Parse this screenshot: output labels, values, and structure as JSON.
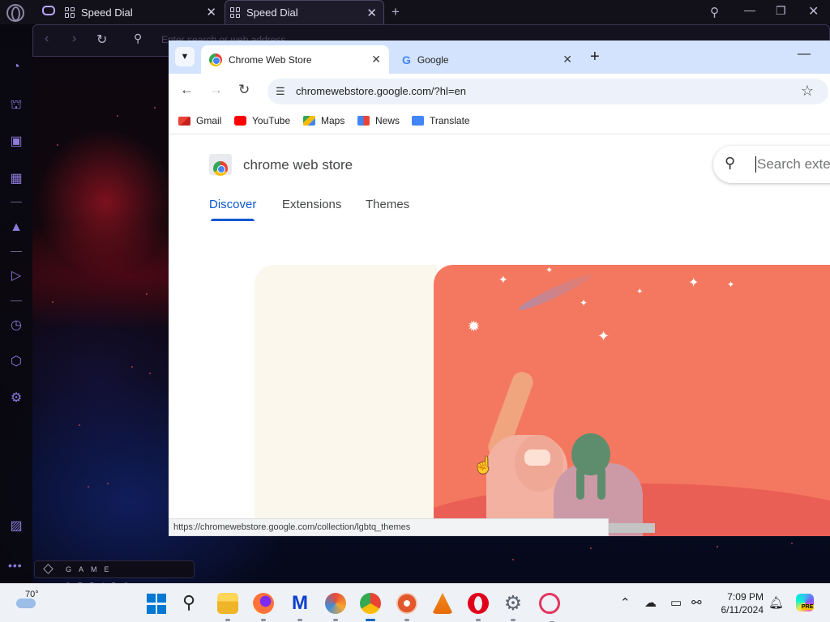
{
  "opera": {
    "tabs": [
      {
        "label": "Speed Dial",
        "icon": "speed-dial-icon"
      },
      {
        "label": "Speed Dial",
        "icon": "speed-dial-icon",
        "active": true
      }
    ],
    "address_placeholder": "Enter search or web address",
    "game_strips_label": "GAME STRIPS",
    "sidebar_icons": [
      "speedometer-icon",
      "game-controller-icon",
      "twitch-icon",
      "cpu-icon",
      "arc-icon",
      "player-icon",
      "history-icon",
      "cube-icon",
      "settings-gear-icon",
      "gallery-icon",
      "more-dots-icon"
    ],
    "accent_color": "#8d7bdc"
  },
  "chrome": {
    "tabs": [
      {
        "label": "Chrome Web Store",
        "active": true
      },
      {
        "label": "Google",
        "active": false
      }
    ],
    "url": "chromewebstore.google.com/?hl=en",
    "bookmarks": [
      "Gmail",
      "YouTube",
      "Maps",
      "News",
      "Translate"
    ],
    "store": {
      "title": "chrome web store",
      "search_placeholder": "Search exter",
      "nav": [
        "Discover",
        "Extensions",
        "Themes"
      ],
      "selected_nav": "Discover"
    },
    "status_url": "https://chromewebstore.google.com/collection/lgbtq_themes",
    "accent_color": "#0b57d0"
  },
  "taskbar": {
    "temperature": "70°",
    "time": "7:09 PM",
    "date": "6/11/2024",
    "copilot_badge": "PRE",
    "apps": [
      "start-icon",
      "search-icon",
      "file-explorer-icon",
      "firefox-icon",
      "malwarebytes-icon",
      "ccleaner-icon",
      "chrome-icon",
      "disc-app-icon",
      "vlc-icon",
      "opera-icon",
      "settings-icon",
      "opera-gx-icon"
    ]
  }
}
